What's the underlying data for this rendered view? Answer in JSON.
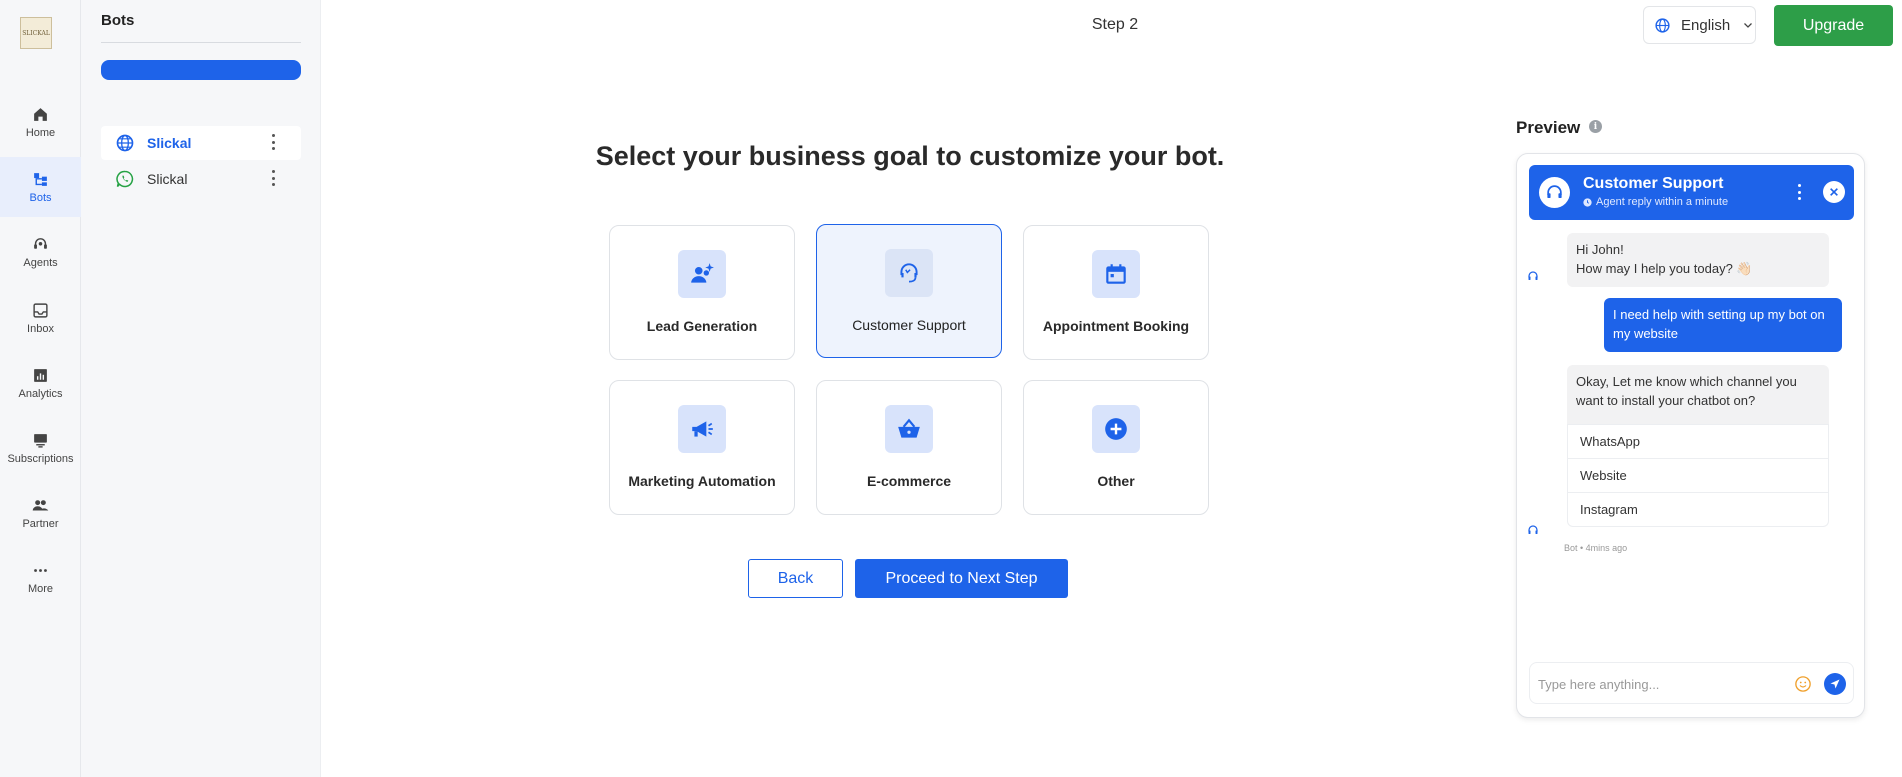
{
  "app": {
    "logo_text": "SLICKAL"
  },
  "nav": {
    "items": [
      {
        "label": "Home",
        "icon": "home-icon"
      },
      {
        "label": "Bots",
        "icon": "bots-icon",
        "active": true
      },
      {
        "label": "Agents",
        "icon": "agents-icon"
      },
      {
        "label": "Inbox",
        "icon": "inbox-icon"
      },
      {
        "label": "Analytics",
        "icon": "analytics-icon"
      },
      {
        "label": "Subscriptions",
        "icon": "subscriptions-icon"
      },
      {
        "label": "Partner",
        "icon": "partner-icon"
      },
      {
        "label": "More",
        "icon": "more-icon"
      }
    ]
  },
  "bots_panel": {
    "title": "Bots",
    "bots": [
      {
        "name": "Slickal",
        "channel": "website",
        "active": true
      },
      {
        "name": "Slickal",
        "channel": "whatsapp"
      }
    ]
  },
  "header": {
    "step": "Step 2",
    "language": "English",
    "upgrade_label": "Upgrade"
  },
  "main": {
    "heading": "Select your business goal to customize your bot.",
    "goals": [
      {
        "label": "Lead Generation",
        "icon": "lead-generation-icon"
      },
      {
        "label": "Customer Support",
        "icon": "customer-support-icon",
        "selected": true
      },
      {
        "label": "Appointment Booking",
        "icon": "calendar-icon"
      },
      {
        "label": "Marketing Automation",
        "icon": "megaphone-icon"
      },
      {
        "label": "E-commerce",
        "icon": "basket-icon"
      },
      {
        "label": "Other",
        "icon": "plus-icon"
      }
    ],
    "back_label": "Back",
    "next_label": "Proceed to Next Step"
  },
  "preview": {
    "title": "Preview",
    "bot_name": "Customer Support",
    "bot_status": "Agent reply within a minute",
    "messages": {
      "greeting_line1": "Hi John!",
      "greeting_line2": "How may I help you today? 👋🏻",
      "user_message": "I need help with setting up my bot on my website",
      "bot_question": "Okay, Let me know which channel you want to install your chatbot on?",
      "options": [
        "WhatsApp",
        "Website",
        "Instagram"
      ],
      "meta": "Bot • 4mins ago"
    },
    "input_placeholder": "Type here anything..."
  },
  "colors": {
    "primary": "#1e63e9",
    "upgrade": "#2d9e48",
    "sidebar_bg": "#f6f7f9",
    "selected_card_bg": "#eef3fd",
    "whatsapp": "#25a244",
    "emoji": "#f0a02c"
  }
}
